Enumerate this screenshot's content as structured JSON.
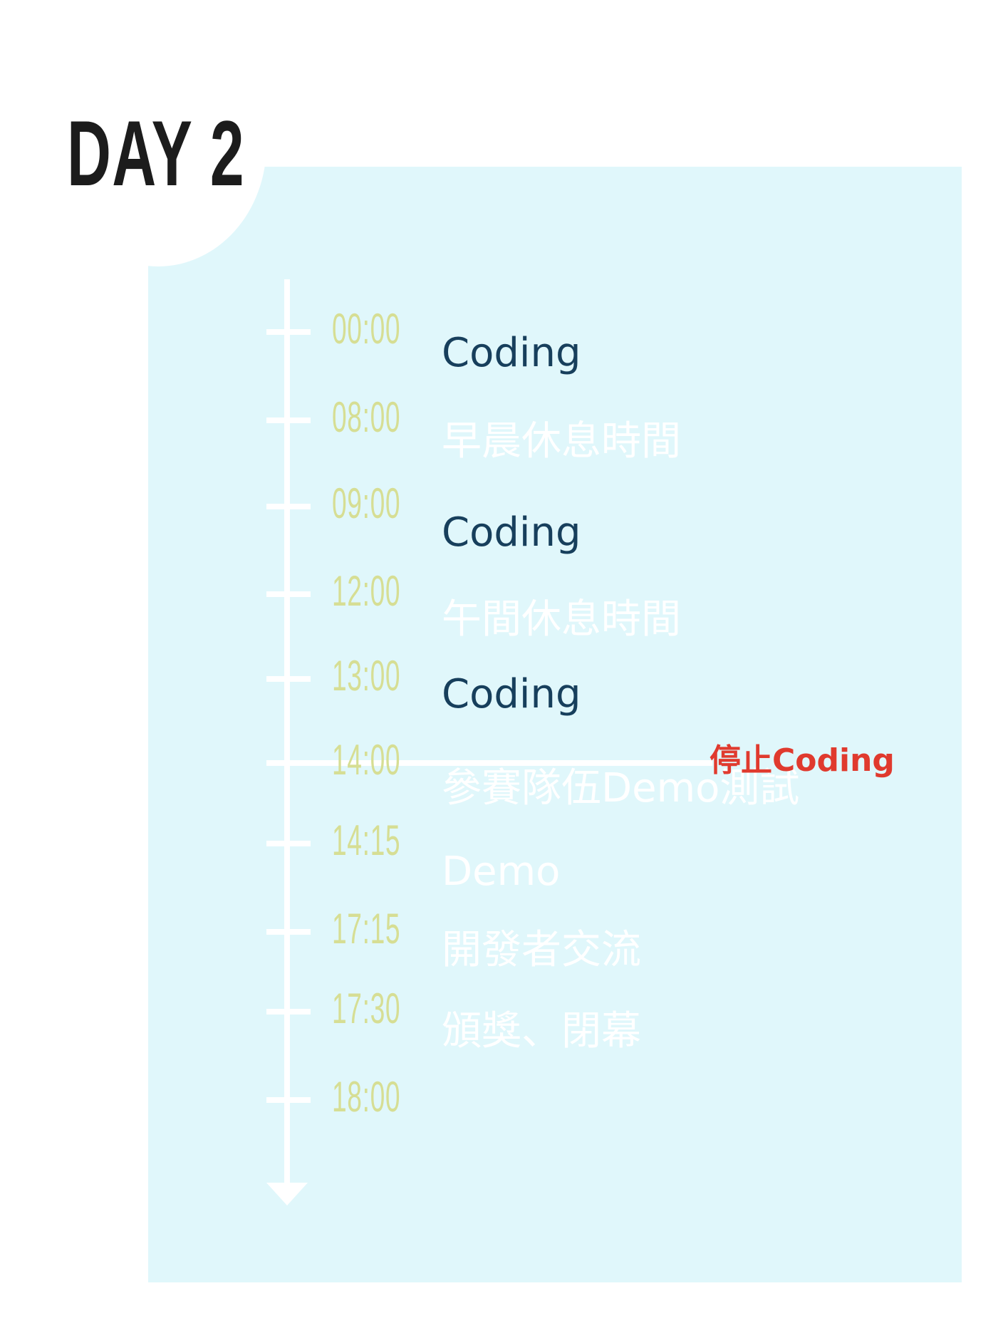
{
  "day_title": "DAY 2",
  "colors": {
    "panel": "#e0f7fb",
    "time": "#d6de94",
    "coding": "#173f5c",
    "faded_event": "#ffffff",
    "stop": "#e03a2e",
    "title": "#1c1c1c"
  },
  "times": [
    "00:00",
    "08:00",
    "09:00",
    "12:00",
    "13:00",
    "14:00",
    "14:15",
    "17:15",
    "17:30",
    "18:00"
  ],
  "events": [
    {
      "label": "Coding",
      "style": "dark"
    },
    {
      "label": "早晨休息時間",
      "style": "light"
    },
    {
      "label": "Coding",
      "style": "dark"
    },
    {
      "label": "午間休息時間",
      "style": "light"
    },
    {
      "label": "Coding",
      "style": "dark"
    },
    {
      "label": "參賽隊伍Demo測試",
      "style": "light"
    },
    {
      "label": "Demo",
      "style": "light"
    },
    {
      "label": "開發者交流",
      "style": "light"
    },
    {
      "label": "頒獎、閉幕",
      "style": "light"
    }
  ],
  "stop_marker": {
    "label": "停止Coding",
    "at_time": "14:00"
  }
}
